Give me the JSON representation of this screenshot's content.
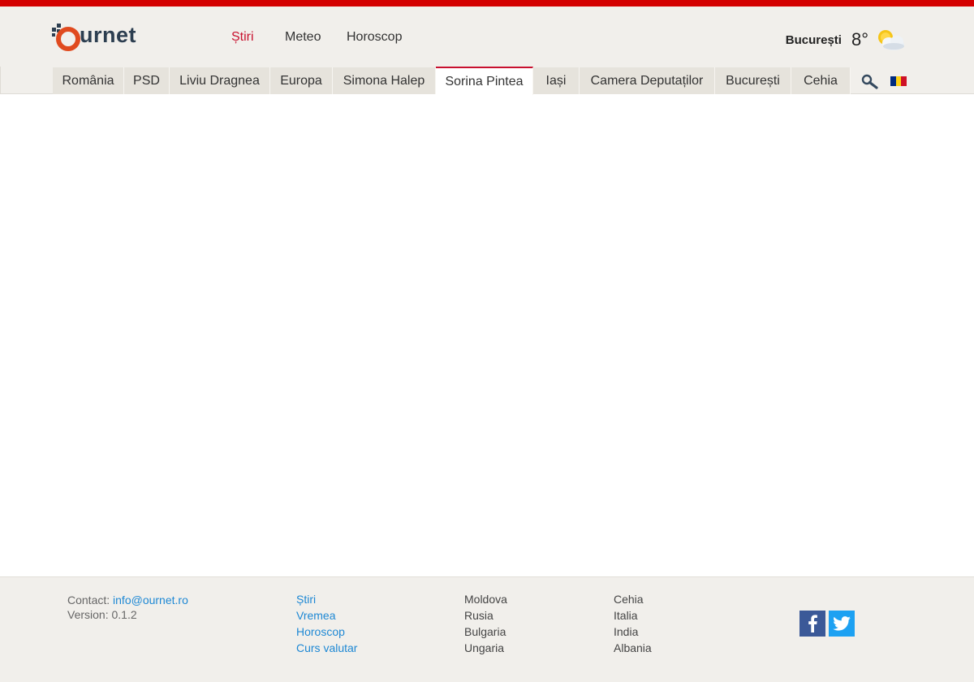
{
  "brand": {
    "logo_text": "urnet",
    "logo_letter": "O"
  },
  "main_nav": [
    {
      "label": "Știri",
      "active": true
    },
    {
      "label": "Meteo",
      "active": false
    },
    {
      "label": "Horoscop",
      "active": false
    }
  ],
  "weather": {
    "city": "București",
    "temperature": "8°",
    "icon": "partly-cloudy-icon"
  },
  "tabs": [
    {
      "label": "România",
      "active": false
    },
    {
      "label": "PSD",
      "active": false
    },
    {
      "label": "Liviu Dragnea",
      "active": false
    },
    {
      "label": "Europa",
      "active": false
    },
    {
      "label": "Simona Halep",
      "active": false
    },
    {
      "label": "Sorina Pintea",
      "active": true
    },
    {
      "label": "Iași",
      "active": false
    },
    {
      "label": "Camera Deputaților",
      "active": false
    },
    {
      "label": "București",
      "active": false
    },
    {
      "label": "Cehia",
      "active": false
    }
  ],
  "toolbar": {
    "search_icon": "search-icon",
    "flag_icon": "romania-flag-icon"
  },
  "footer": {
    "contact_label": "Contact:",
    "contact_email": "info@ournet.ro",
    "version": "Version: 0.1.2",
    "links": [
      "Știri",
      "Vremea",
      "Horoscop",
      "Curs valutar"
    ],
    "countries_col1": [
      "Moldova",
      "Rusia",
      "Bulgaria",
      "Ungaria"
    ],
    "countries_col2": [
      "Cehia",
      "Italia",
      "India",
      "Albania"
    ],
    "social": [
      "facebook-icon",
      "twitter-icon"
    ]
  },
  "colors": {
    "accent": "#c8102e",
    "topbar": "#d40000",
    "link": "#1e88d4",
    "facebook": "#3b5998",
    "twitter": "#1da1f2"
  }
}
